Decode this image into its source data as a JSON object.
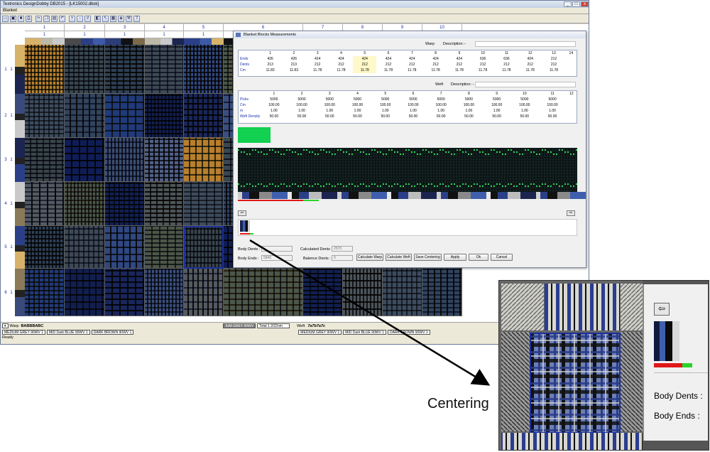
{
  "window": {
    "title": "Textronics DesignDobby DB2015 - [LK15002.dbsk]",
    "subtitle": "Blanket",
    "controls": {
      "minimize": "_",
      "restore": "□",
      "close": "x"
    }
  },
  "toolbar": {
    "icons": [
      "new-icon",
      "open-icon",
      "save-icon",
      "print-icon",
      "cut-icon",
      "copy-icon",
      "paste-icon",
      "undo-icon",
      "zoom-in-icon",
      "zoom-out-icon",
      "grid-icon",
      "fill-icon",
      "arrow-icon",
      "weave-icon",
      "color-icon",
      "tools-icon",
      "help-icon"
    ]
  },
  "grid": {
    "column_numbers": [
      "1",
      "2",
      "3",
      "4",
      "5",
      "6",
      "7",
      "8",
      "9",
      "10"
    ],
    "column_repeats": [
      "1",
      "1",
      "1",
      "1",
      "1",
      "1",
      "1",
      "1",
      "1",
      "1"
    ],
    "row_labels": [
      {
        "num": "1",
        "rep": "1"
      },
      {
        "num": "2",
        "rep": "1"
      },
      {
        "num": "3",
        "rep": "1"
      },
      {
        "num": "4",
        "rep": "1"
      },
      {
        "num": "5",
        "rep": "1"
      },
      {
        "num": "6",
        "rep": "1"
      }
    ]
  },
  "bottom": {
    "warp_label": "Warp",
    "warp_value": "BABBBABC",
    "warp_color_pill": "IUM GREY 90WV",
    "total": "Total 1 2/22nm",
    "weft_label": "Weft",
    "weft_value": "7a7b7a7c",
    "yarn_pills_left": [
      "MEDIUM GREY 90WV 1",
      "MID Dark BLUE 90WV 1",
      "DARK BROWN 90WV 1"
    ],
    "yarn_pills_right": [
      "MEDIUM GREY 90WV 1",
      "MID Dark BLUE 90WV 1",
      "DARK BROWN 90WV 1"
    ],
    "status": "Ready"
  },
  "dialog": {
    "title": "Blanket Blocks Measurements",
    "warp_section": "Warp",
    "weft_section": "Weft",
    "description_label": "Description :-",
    "warp_table": {
      "columns": [
        "1",
        "2",
        "3",
        "4",
        "5",
        "6",
        "7",
        "8",
        "9",
        "10",
        "11",
        "12",
        "13",
        "14"
      ],
      "rows": [
        {
          "label": "Ends",
          "values": [
            "426",
            "426",
            "424",
            "424",
            "424",
            "424",
            "424",
            "424",
            "424",
            "636",
            "636",
            "424",
            "212"
          ]
        },
        {
          "label": "Dents",
          "values": [
            "213",
            "213",
            "212",
            "212",
            "212",
            "212",
            "212",
            "212",
            "212",
            "212",
            "212",
            "212",
            "212"
          ]
        },
        {
          "label": "Cm",
          "values": [
            "11.83",
            "11.83",
            "11.78",
            "11.78",
            "11.78",
            "11.78",
            "11.78",
            "11.78",
            "11.78",
            "11.78",
            "11.78",
            "11.78",
            "11.78"
          ]
        }
      ],
      "highlight_column": 4
    },
    "weft_table": {
      "columns": [
        "1",
        "2",
        "3",
        "4",
        "5",
        "6",
        "7",
        "8",
        "9",
        "10",
        "11",
        "12"
      ],
      "rows": [
        {
          "label": "Picks",
          "values": [
            "5000",
            "5000",
            "5000",
            "5000",
            "5000",
            "5000",
            "5000",
            "5000",
            "5000",
            "5000",
            "5000"
          ]
        },
        {
          "label": "Cm",
          "values": [
            "100.00",
            "100.00",
            "100.00",
            "100.00",
            "100.00",
            "100.00",
            "100.00",
            "100.00",
            "100.00",
            "100.00",
            "100.00"
          ]
        },
        {
          "label": "m",
          "values": [
            "1.00",
            "1.00",
            "1.00",
            "1.00",
            "1.00",
            "1.00",
            "1.00",
            "1.00",
            "1.00",
            "1.00",
            "1.00"
          ]
        },
        {
          "label": "Weft Density",
          "values": [
            "50.00",
            "50.00",
            "50.00",
            "50.00",
            "50.00",
            "50.00",
            "50.00",
            "50.00",
            "50.00",
            "50.00",
            "50.00"
          ]
        }
      ]
    },
    "body_dents_label": "Body Dents :",
    "body_dents_value": "",
    "body_ends_label": "Body Ends :",
    "body_ends_value": "5840",
    "calculated_dents_label": "Calculated Dents :",
    "calculated_dents_value": "2570",
    "balance_dents_label": "Balence Dents :",
    "balance_dents_value": "0",
    "buttons": [
      "Calculate Warp",
      "Calculate Weft",
      "Save Centering",
      "Apply",
      "Ok",
      "Cancel"
    ]
  },
  "zoom": {
    "body_dents_label": "Body Dents :",
    "body_ends_label": "Body Ends :"
  },
  "annotation": {
    "label": "Centering"
  },
  "colors": {
    "accent_blue": "#1a2ea8",
    "green_block": "#12d050",
    "red_bar": "#e01818",
    "green_bar": "#2bd42b",
    "selection_border": "#1c2f9a"
  }
}
